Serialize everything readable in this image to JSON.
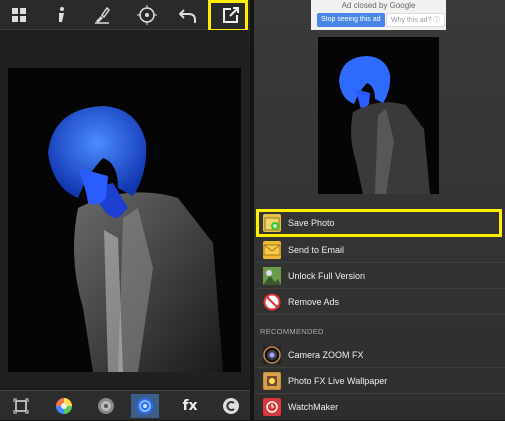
{
  "toolbar": {
    "icons": [
      "grid-icon",
      "info-icon",
      "brush-icon",
      "target-icon",
      "undo-icon",
      "share-icon"
    ]
  },
  "editor": {
    "tools": [
      "crop-icon",
      "color-wheel-icon",
      "lens-icon",
      "blur-icon",
      "fx-icon",
      "c-icon"
    ],
    "fx_label": "fx",
    "selected_tool": "blur-icon"
  },
  "ad": {
    "closed_by": "Ad closed by Google",
    "stop_label": "Stop seeing this ad",
    "why_label": "Why this ad? ⓘ"
  },
  "menu": {
    "items": [
      {
        "label": "Save Photo",
        "icon": "save-icon"
      },
      {
        "label": "Send to Email",
        "icon": "email-icon"
      },
      {
        "label": "Unlock Full Version",
        "icon": "unlock-icon"
      },
      {
        "label": "Remove Ads",
        "icon": "no-ads-icon"
      }
    ],
    "recommended_title": "RECOMMENDED",
    "recommended": [
      {
        "label": "Camera ZOOM FX",
        "icon": "camera-zoom-fx-icon"
      },
      {
        "label": "Photo FX Live Wallpaper",
        "icon": "photo-fx-icon"
      },
      {
        "label": "WatchMaker",
        "icon": "watchmaker-icon"
      }
    ]
  },
  "colors": {
    "highlight": "#ffee00",
    "tint": "#2a5cff",
    "accent": "#4a86e8"
  }
}
